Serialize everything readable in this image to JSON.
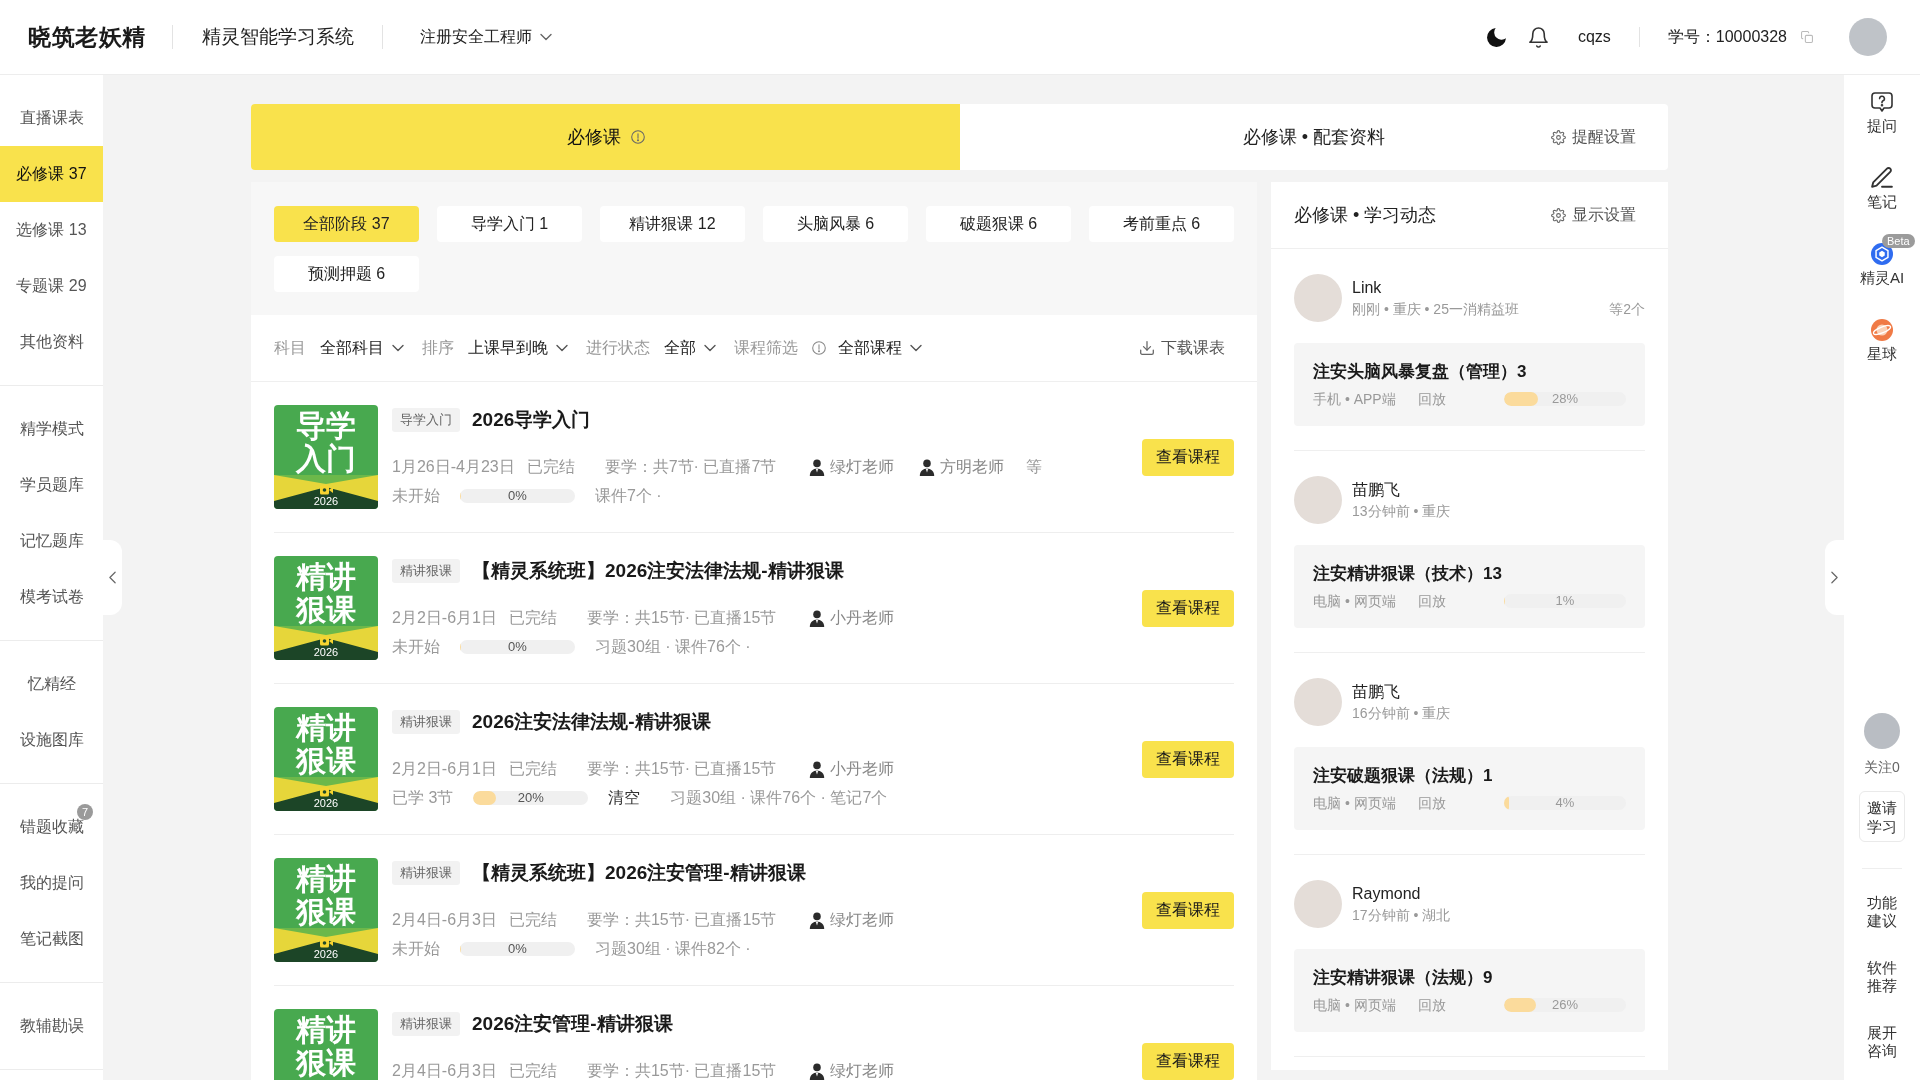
{
  "header": {
    "logo": "晓筑老妖精",
    "system_name": "精灵智能学习系统",
    "exam": "注册安全工程师",
    "username": "cqzs",
    "student_id": "学号：10000328"
  },
  "sidebar": {
    "groups": [
      {
        "items": [
          {
            "label": "直播课表",
            "selected": false
          },
          {
            "label": "必修课 37",
            "selected": true
          },
          {
            "label": "选修课 13",
            "selected": false
          },
          {
            "label": "专题课 29",
            "selected": false
          },
          {
            "label": "其他资料",
            "selected": false
          }
        ]
      },
      {
        "items": [
          {
            "label": "精学模式",
            "selected": false
          },
          {
            "label": "学员题库",
            "selected": false
          },
          {
            "label": "记忆题库",
            "selected": false
          },
          {
            "label": "模考试卷",
            "selected": false
          }
        ]
      },
      {
        "items": [
          {
            "label": "忆精经",
            "selected": false
          },
          {
            "label": "设施图库",
            "selected": false
          }
        ]
      },
      {
        "items": [
          {
            "label": "错题收藏",
            "selected": false,
            "badge": "7"
          },
          {
            "label": "我的提问",
            "selected": false
          },
          {
            "label": "笔记截图",
            "selected": false
          }
        ]
      },
      {
        "items": [
          {
            "label": "教辅勘误",
            "selected": false
          }
        ]
      }
    ]
  },
  "tab_bar": {
    "tabs": [
      {
        "label": "必修课",
        "selected": true,
        "info": true
      },
      {
        "label": "必修课 • 配套资料",
        "selected": false,
        "info": false
      }
    ],
    "reminder_settings": "提醒设置"
  },
  "course_panel": {
    "stage_filters": [
      {
        "label": "全部阶段 37",
        "selected": true
      },
      {
        "label": "导学入门 1",
        "selected": false
      },
      {
        "label": "精讲狠课 12",
        "selected": false
      },
      {
        "label": "头脑风暴 6",
        "selected": false
      },
      {
        "label": "破题狠课 6",
        "selected": false
      },
      {
        "label": "考前重点 6",
        "selected": false
      },
      {
        "label": "预测押题 6",
        "selected": false
      }
    ],
    "filters": [
      {
        "label": "科目",
        "value": "全部科目",
        "info": false
      },
      {
        "label": "排序",
        "value": "上课早到晚",
        "info": false
      },
      {
        "label": "进行状态",
        "value": "全部",
        "info": false
      },
      {
        "label": "课程筛选",
        "value": "全部课程",
        "info": true
      }
    ],
    "download": "下载课表",
    "courses": [
      {
        "cover_title": "导学入门",
        "cover_year": "2026",
        "tag": "导学入门",
        "title": "2026导学入门",
        "dates": "1月26日-4月23日",
        "status": "已完结",
        "lessons": "要学：共7节· 已直播7节",
        "teachers": [
          "绿灯老师",
          "方明老师"
        ],
        "more": "等",
        "progress_label": "未开始",
        "level": 0,
        "percent": "0%",
        "extras": "课件7个 ·",
        "button": "查看课程"
      },
      {
        "cover_title": "精讲狠课",
        "cover_year": "2026",
        "tag": "精讲狠课",
        "title": "【精灵系统班】2026注安法律法规-精讲狠课",
        "dates": "2月2日-6月1日",
        "status": "已完结",
        "lessons": "要学：共15节· 已直播15节",
        "teachers": [
          "小丹老师"
        ],
        "progress_label": "未开始",
        "level": 0,
        "percent": "0%",
        "extras": "习题30组 · 课件76个 ·",
        "button": "查看课程"
      },
      {
        "cover_title": "精讲狠课",
        "cover_year": "2026",
        "tag": "精讲狠课",
        "title": "2026注安法律法规-精讲狠课",
        "dates": "2月2日-6月1日",
        "status": "已完结",
        "lessons": "要学：共15节· 已直播15节",
        "teachers": [
          "小丹老师"
        ],
        "progress_label": "已学 3节",
        "level": 0.2,
        "percent": "20%",
        "clear_label": "清空",
        "extras": "习题30组 · 课件76个 · 笔记7个",
        "button": "查看课程"
      },
      {
        "cover_title": "精讲狠课",
        "cover_year": "2026",
        "tag": "精讲狠课",
        "title": "【精灵系统班】2026注安管理-精讲狠课",
        "dates": "2月4日-6月3日",
        "status": "已完结",
        "lessons": "要学：共15节· 已直播15节",
        "teachers": [
          "绿灯老师"
        ],
        "progress_label": "未开始",
        "level": 0,
        "percent": "0%",
        "extras": "习题30组 · 课件82个 ·",
        "button": "查看课程"
      },
      {
        "cover_title": "精讲狠课",
        "tag": "精讲狠课",
        "title": "2026注安管理-精讲狠课",
        "dates": "2月4日-6月3日",
        "status": "已完结",
        "lessons": "要学：共15节· 已直播15节",
        "teachers": [
          "绿灯老师"
        ],
        "button": "查看课程"
      }
    ]
  },
  "activity": {
    "title": "必修课 • 学习动态",
    "settings": "显示设置",
    "entries": [
      {
        "user": "Link",
        "meta": "刚刚 • 重庆 • 25一消精益班",
        "extra": "等2个",
        "course": "注安头脑风暴复盘（管理）3",
        "device": "手机 • APP端",
        "mode": "回放",
        "level": 0.28,
        "percent": "28%"
      },
      {
        "user": "苗鹏飞",
        "meta": "13分钟前 • 重庆",
        "course": "注安精讲狠课（技术）13",
        "device": "电脑 • 网页端",
        "mode": "回放",
        "level": 0.01,
        "percent": "1%"
      },
      {
        "user": "苗鹏飞",
        "meta": "16分钟前 • 重庆",
        "course": "注安破题狠课（法规）1",
        "device": "电脑 • 网页端",
        "mode": "回放",
        "level": 0.04,
        "percent": "4%"
      },
      {
        "user": "Raymond",
        "meta": "17分钟前 • 湖北",
        "course": "注安精讲狠课（法规）9",
        "device": "电脑 • 网页端",
        "mode": "回放",
        "level": 0.26,
        "percent": "26%"
      }
    ]
  },
  "right_rail": {
    "tools": [
      {
        "kind": "question",
        "label": "提问"
      },
      {
        "kind": "note",
        "label": "笔记"
      },
      {
        "kind": "ai",
        "label": "精灵AI",
        "badge": "Beta"
      },
      {
        "kind": "planet",
        "label": "星球"
      }
    ],
    "follow": "关注0",
    "invite": "邀请学习",
    "links": [
      "功能建议",
      "软件推荐",
      "展开咨询"
    ]
  }
}
